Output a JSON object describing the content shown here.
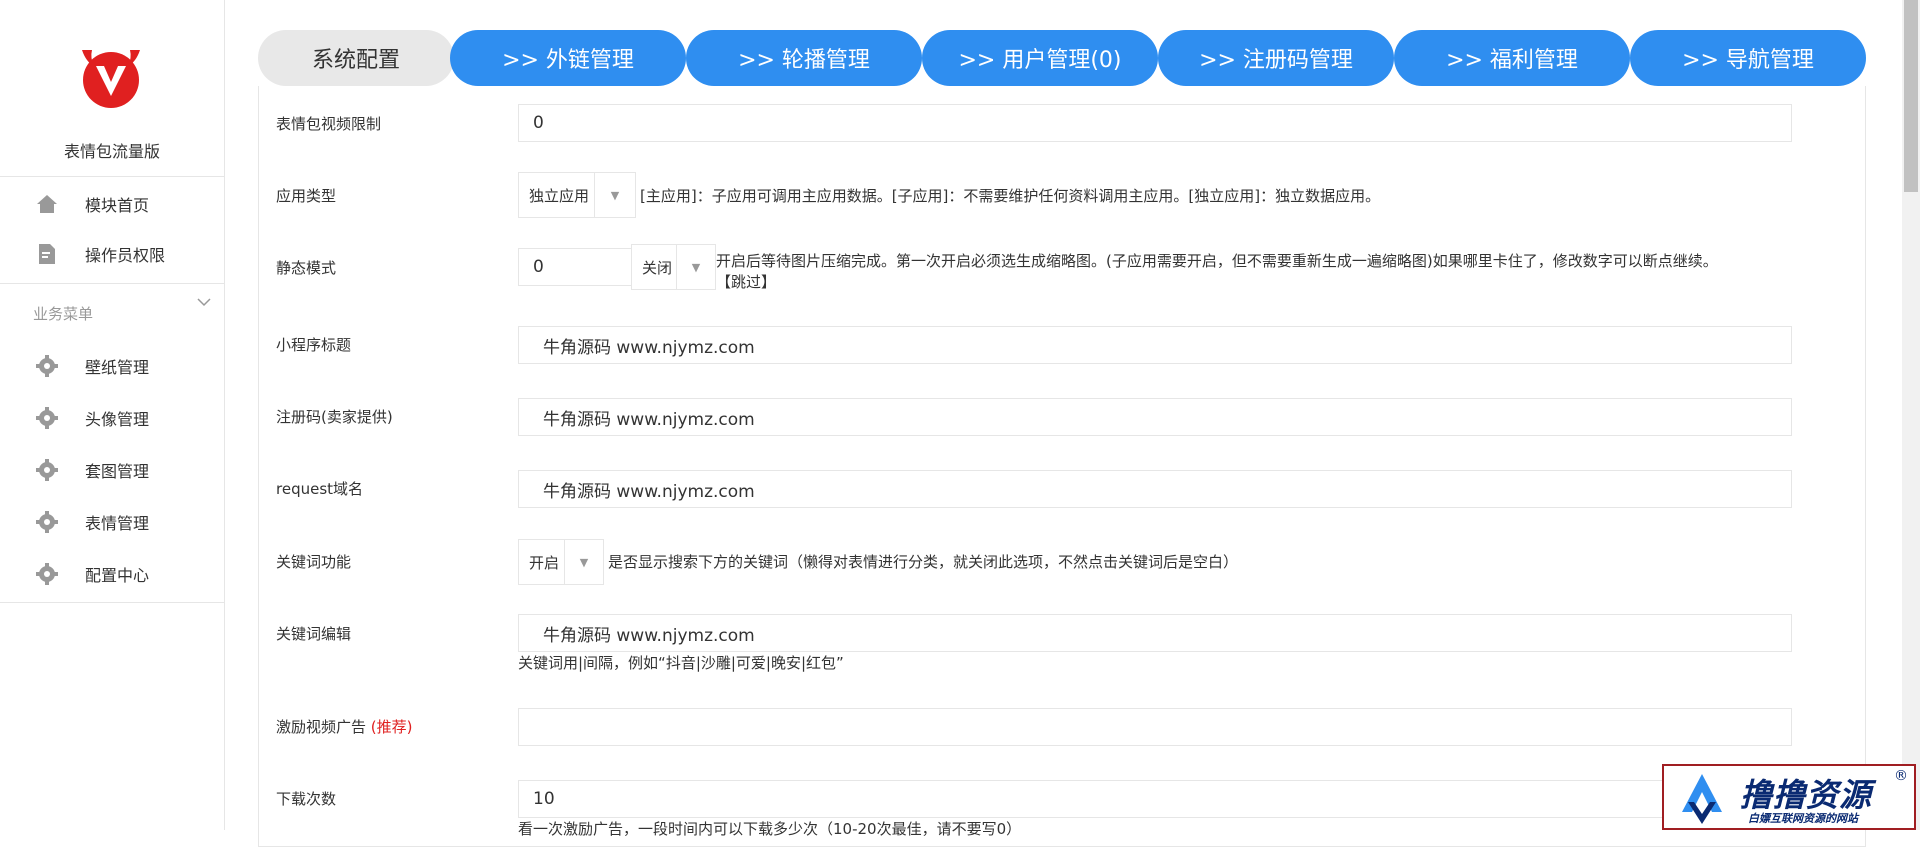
{
  "sidebar": {
    "app_name": "表情包流量版",
    "top_items": [
      {
        "label": "模块首页",
        "icon": "home-icon"
      },
      {
        "label": "操作员权限",
        "icon": "document-icon"
      }
    ],
    "section_title": "业务菜单",
    "section_items": [
      {
        "label": "壁纸管理",
        "icon": "gear-icon"
      },
      {
        "label": "头像管理",
        "icon": "gear-icon"
      },
      {
        "label": "套图管理",
        "icon": "gear-icon"
      },
      {
        "label": "表情管理",
        "icon": "gear-icon"
      },
      {
        "label": "配置中心",
        "icon": "gear-icon"
      }
    ]
  },
  "tabs": [
    {
      "label": "系统配置",
      "active": true
    },
    {
      "label": ">> 外链管理",
      "active": false
    },
    {
      "label": ">> 轮播管理",
      "active": false
    },
    {
      "label": ">> 用户管理(0)",
      "active": false
    },
    {
      "label": ">> 注册码管理",
      "active": false
    },
    {
      "label": ">> 福利管理",
      "active": false
    },
    {
      "label": ">> 导航管理",
      "active": false
    }
  ],
  "form": {
    "video_limit": {
      "label": "表情包视频限制",
      "value": "0"
    },
    "app_type": {
      "label": "应用类型",
      "selected": "独立应用",
      "desc": "[主应用]：子应用可调用主应用数据。[子应用]：不需要维护任何资料调用主应用。[独立应用]：独立数据应用。"
    },
    "static_mode": {
      "label": "静态模式",
      "value": "0",
      "selected": "关闭",
      "desc1": "开启后等待图片压缩完成。第一次开启必须选生成缩略图。(子应用需要开启，但不需要重新生成一遍缩略图)如果哪里卡住了，修改数字可以断点继续。",
      "desc2": "【跳过】"
    },
    "mini_title": {
      "label": "小程序标题",
      "value": "牛角源码 www.njymz.com"
    },
    "reg_code": {
      "label": "注册码(卖家提供)",
      "value": "牛角源码 www.njymz.com"
    },
    "request_domain": {
      "label": "request域名",
      "value": "牛角源码 www.njymz.com"
    },
    "keyword_func": {
      "label": "关键词功能",
      "selected": "开启",
      "desc": "是否显示搜索下方的关键词（懒得对表情进行分类，就关闭此选项，不然点击关键词后是空白）"
    },
    "keyword_edit": {
      "label": "关键词编辑",
      "value": "牛角源码 www.njymz.com",
      "hint": "关键词用|间隔，例如“抖音|沙雕|可爱|晚安|红包”"
    },
    "reward_ad": {
      "label": "激励视频广告",
      "label_hl": "(推荐)",
      "value": ""
    },
    "download_count": {
      "label": "下载次数",
      "value": "10",
      "hint": "看一次激励广告，一段时间内可以下载多少次（10-20次最佳，请不要写0）"
    }
  },
  "watermark": {
    "title": "撸撸资源",
    "subtitle": "白嫖互联网资源的网站",
    "reg": "®"
  },
  "colors": {
    "tab_blue": "#2f8ef0",
    "tab_active": "#e8e8e8",
    "logo_red": "#e02020",
    "highlight": "#e02020"
  }
}
